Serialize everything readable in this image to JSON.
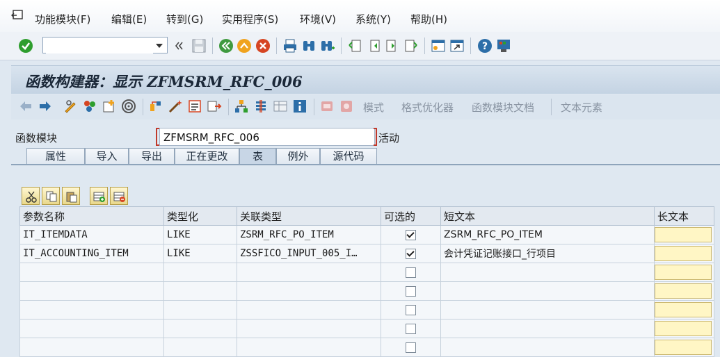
{
  "menu": {
    "items": [
      "功能模块(F)",
      "编辑(E)",
      "转到(G)",
      "实用程序(S)",
      "环境(V)",
      "系统(Y)",
      "帮助(H)"
    ]
  },
  "toolbar": {
    "command_value": ""
  },
  "title": "函数构建器：显示 ZFMSRM_RFC_006",
  "app_toolbar": {
    "buttons": [
      "模式",
      "格式优化器",
      "函数模块文档",
      "文本元素"
    ]
  },
  "function_module": {
    "label": "函数模块",
    "value": "ZFMSRM_RFC_006",
    "status": "活动"
  },
  "tabs": [
    "属性",
    "导入",
    "导出",
    "正在更改",
    "表",
    "例外",
    "源代码"
  ],
  "active_tab": "表",
  "table": {
    "headers": [
      "参数名称",
      "类型化",
      "关联类型",
      "可选的",
      "短文本",
      "长文本"
    ],
    "rows": [
      {
        "name": "IT_ITEMDATA",
        "typing": "LIKE",
        "ref_type": "ZSRM_RFC_PO_ITEM",
        "optional": true,
        "short_text": "ZSRM_RFC_PO_ITEM"
      },
      {
        "name": "IT_ACCOUNTING_ITEM",
        "typing": "LIKE",
        "ref_type": "ZSSFICO_INPUT_005_I…",
        "optional": true,
        "short_text": "会计凭证记账接口_行项目"
      },
      {
        "name": "",
        "typing": "",
        "ref_type": "",
        "optional": false,
        "short_text": ""
      },
      {
        "name": "",
        "typing": "",
        "ref_type": "",
        "optional": false,
        "short_text": ""
      },
      {
        "name": "",
        "typing": "",
        "ref_type": "",
        "optional": false,
        "short_text": ""
      },
      {
        "name": "",
        "typing": "",
        "ref_type": "",
        "optional": false,
        "short_text": ""
      },
      {
        "name": "",
        "typing": "",
        "ref_type": "",
        "optional": false,
        "short_text": ""
      }
    ]
  },
  "colors": {
    "accent": "#1f6fb2",
    "enter_green": "#2e9e2e",
    "cancel_red": "#d64522",
    "long_text_button": "#fff6c5"
  }
}
